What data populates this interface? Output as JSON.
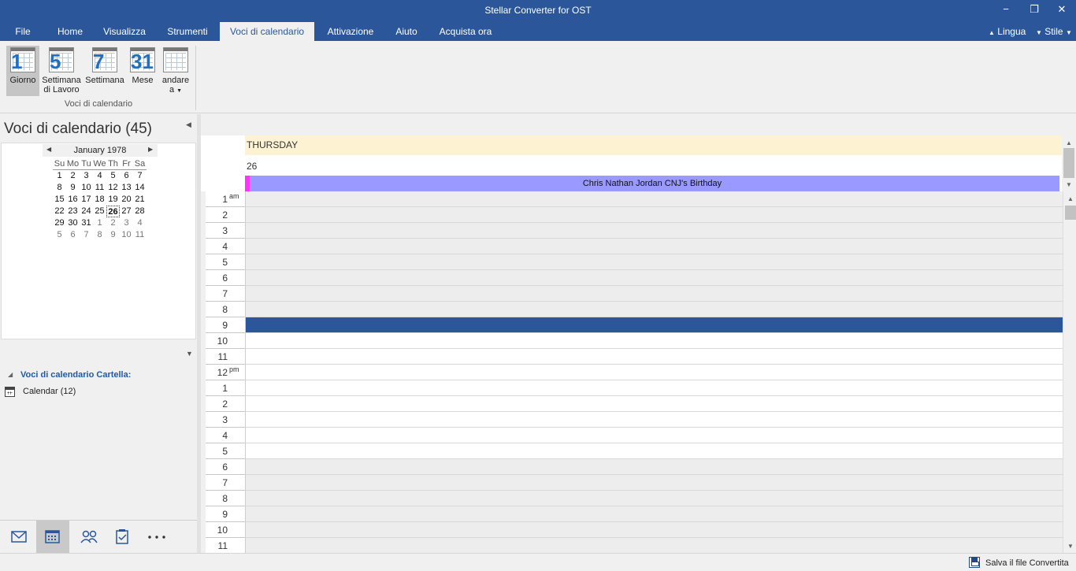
{
  "app": {
    "title": "Stellar Converter for OST",
    "minimize_glyph": "−",
    "restore_glyph": "❐",
    "close_glyph": "✕"
  },
  "menu": {
    "tabs": [
      {
        "label": "File"
      },
      {
        "label": "Home"
      },
      {
        "label": "Visualizza"
      },
      {
        "label": "Strumenti"
      },
      {
        "label": "Voci di calendario",
        "active": true
      },
      {
        "label": "Attivazione"
      },
      {
        "label": "Aiuto"
      },
      {
        "label": "Acquista ora"
      }
    ],
    "language": "Lingua",
    "style": "Stile"
  },
  "ribbon": {
    "buttons": [
      {
        "label": "Giorno",
        "number": "1",
        "icon": "day-calendar-icon",
        "active": true
      },
      {
        "label": "Settimana di Lavoro",
        "line1": "Settimana",
        "line2": "di Lavoro",
        "number": "5",
        "icon": "work-week-calendar-icon"
      },
      {
        "label": "Settimana",
        "number": "7",
        "icon": "week-calendar-icon"
      },
      {
        "label": "Mese",
        "number": "31",
        "icon": "month-calendar-icon"
      },
      {
        "label": "andare a",
        "line1": "andare",
        "line2": "a",
        "number": "",
        "icon": "goto-calendar-icon"
      }
    ],
    "group_label": "Voci di calendario"
  },
  "left_pane": {
    "title": "Voci di calendario (45)",
    "mini_calendar": {
      "month": "January 1978",
      "days_of_week": [
        "Su",
        "Mo",
        "Tu",
        "We",
        "Th",
        "Fr",
        "Sa"
      ],
      "weeks": [
        [
          {
            "d": "1"
          },
          {
            "d": "2"
          },
          {
            "d": "3"
          },
          {
            "d": "4"
          },
          {
            "d": "5"
          },
          {
            "d": "6"
          },
          {
            "d": "7"
          }
        ],
        [
          {
            "d": "8"
          },
          {
            "d": "9"
          },
          {
            "d": "10"
          },
          {
            "d": "11"
          },
          {
            "d": "12"
          },
          {
            "d": "13"
          },
          {
            "d": "14"
          }
        ],
        [
          {
            "d": "15"
          },
          {
            "d": "16"
          },
          {
            "d": "17"
          },
          {
            "d": "18"
          },
          {
            "d": "19"
          },
          {
            "d": "20"
          },
          {
            "d": "21"
          }
        ],
        [
          {
            "d": "22"
          },
          {
            "d": "23"
          },
          {
            "d": "24"
          },
          {
            "d": "25"
          },
          {
            "d": "26",
            "today": true
          },
          {
            "d": "27"
          },
          {
            "d": "28"
          }
        ],
        [
          {
            "d": "29"
          },
          {
            "d": "30"
          },
          {
            "d": "31"
          },
          {
            "d": "1",
            "other": true
          },
          {
            "d": "2",
            "other": true
          },
          {
            "d": "3",
            "other": true
          },
          {
            "d": "4",
            "other": true
          }
        ],
        [
          {
            "d": "5",
            "other": true
          },
          {
            "d": "6",
            "other": true
          },
          {
            "d": "7",
            "other": true
          },
          {
            "d": "8",
            "other": true
          },
          {
            "d": "9",
            "other": true
          },
          {
            "d": "10",
            "other": true
          },
          {
            "d": "11",
            "other": true
          }
        ]
      ]
    },
    "folder_section_title": "Voci di calendario Cartella:",
    "folders": [
      {
        "label": "Calendar (12)"
      }
    ]
  },
  "nav_bar": {
    "items": [
      {
        "icon": "mail-icon"
      },
      {
        "icon": "calendar-icon",
        "active": true
      },
      {
        "icon": "contacts-icon"
      },
      {
        "icon": "tasks-icon"
      },
      {
        "icon": "more-icon"
      }
    ]
  },
  "day_view": {
    "day_name": "THURSDAY",
    "day_number": "26",
    "all_day_event": "Chris Nathan Jordan CNJ's Birthday",
    "hours": [
      {
        "label": "1",
        "suffix": "am",
        "state": "off"
      },
      {
        "label": "2",
        "state": "off"
      },
      {
        "label": "3",
        "state": "off"
      },
      {
        "label": "4",
        "state": "off"
      },
      {
        "label": "5",
        "state": "off"
      },
      {
        "label": "6",
        "state": "off"
      },
      {
        "label": "7",
        "state": "off"
      },
      {
        "label": "8",
        "state": "off"
      },
      {
        "label": "9",
        "state": "selected"
      },
      {
        "label": "10",
        "state": "on"
      },
      {
        "label": "11",
        "state": "on"
      },
      {
        "label": "12",
        "suffix": "pm",
        "state": "on"
      },
      {
        "label": "1",
        "state": "on"
      },
      {
        "label": "2",
        "state": "on"
      },
      {
        "label": "3",
        "state": "on"
      },
      {
        "label": "4",
        "state": "on"
      },
      {
        "label": "5",
        "state": "on"
      },
      {
        "label": "6",
        "state": "off"
      },
      {
        "label": "7",
        "state": "off"
      },
      {
        "label": "8",
        "state": "off"
      },
      {
        "label": "9",
        "state": "off"
      },
      {
        "label": "10",
        "state": "off"
      },
      {
        "label": "11",
        "state": "off"
      }
    ]
  },
  "status_bar": {
    "save_label": "Salva il file Convertita"
  },
  "colors": {
    "brand": "#2b579a",
    "event": "#9999ff",
    "event_marker": "#ff33ff",
    "day_header": "#fdf2d2"
  }
}
